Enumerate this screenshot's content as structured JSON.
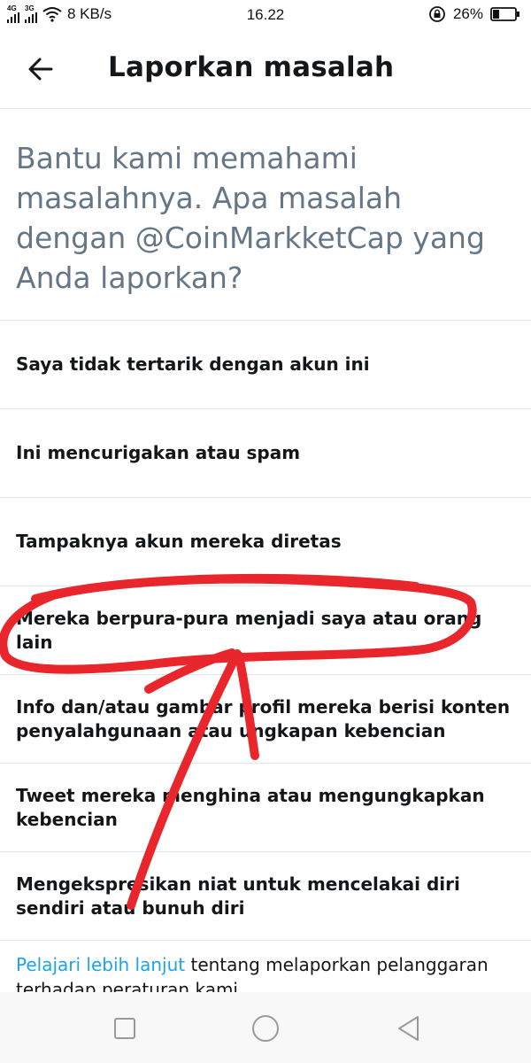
{
  "status_bar": {
    "network_1": "4G",
    "network_2": "3G",
    "speed": "8 KB/s",
    "time": "16.22",
    "battery": "26%"
  },
  "header": {
    "back_icon": "arrow-left-icon",
    "title": "Laporkan masalah"
  },
  "question": "Bantu kami memahami masalahnya. Apa masalah dengan @CoinMarkketCap yang Anda laporkan?",
  "options": [
    "Saya tidak tertarik dengan akun ini",
    "Ini mencurigakan atau spam",
    "Tampaknya akun mereka diretas",
    "Mereka berpura-pura menjadi saya atau orang lain",
    "Info dan/atau gambar profil mereka berisi konten penyalahgunaan atau ungkapan kebencian",
    "Tweet mereka menghina atau mengungkapkan kebencian",
    "Mengekspresikan niat untuk mencelakai diri sendiri atau bunuh diri"
  ],
  "footer": {
    "link_text": "Pelajari lebih lanjut",
    "rest_text": " tentang melaporkan pelanggaran terhadap peraturan kami."
  },
  "nav": {
    "recents_icon": "square-icon",
    "home_icon": "circle-icon",
    "back_icon": "triangle-back-icon"
  },
  "colors": {
    "link": "#1da1f2",
    "annotation": "#e8262b",
    "secondary_text": "#657786"
  }
}
